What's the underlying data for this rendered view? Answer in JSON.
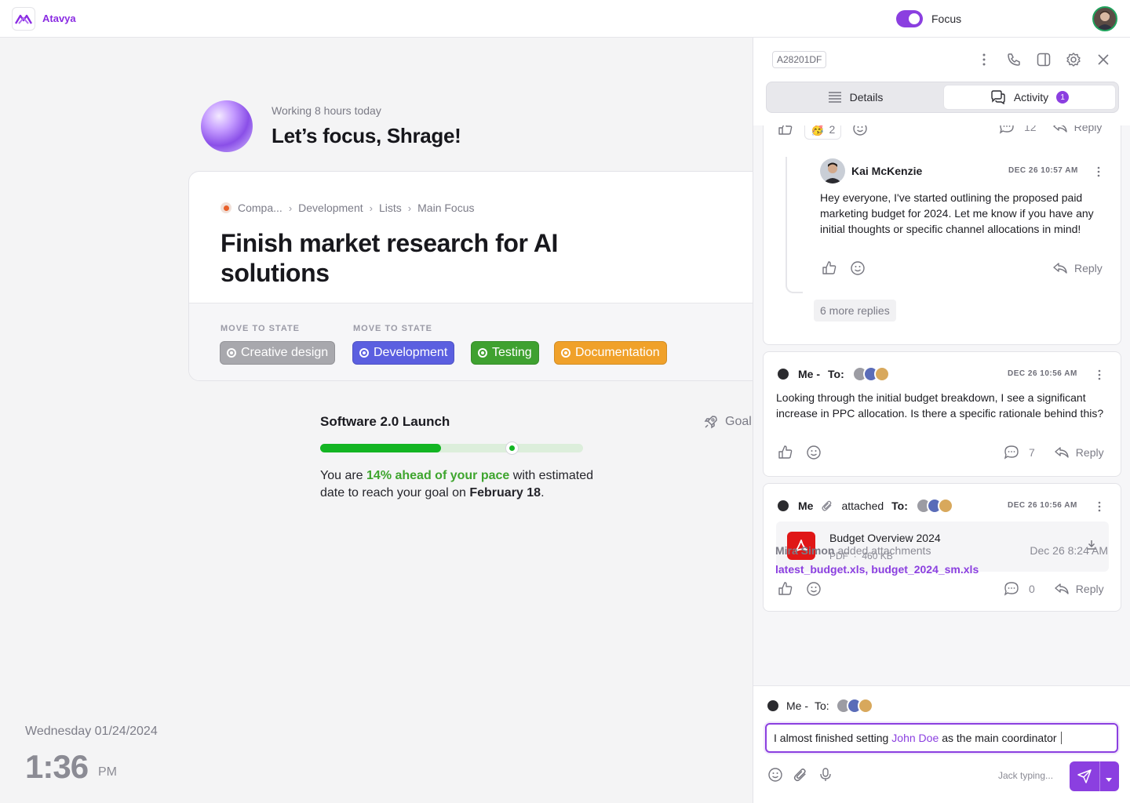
{
  "app": {
    "name": "Atavya"
  },
  "topbar": {
    "focus_label": "Focus",
    "focus_on": true
  },
  "greeting": {
    "subtitle": "Working 8 hours today",
    "title": "Let’s focus, Shrage!"
  },
  "task": {
    "breadcrumbs": [
      "Compa...",
      "Development",
      "Lists",
      "Main Focus"
    ],
    "title": "Finish market research for AI solutions",
    "state_label_1": "MOVE TO STATE",
    "state_label_2": "MOVE TO STATE",
    "states": [
      {
        "label": "Creative design",
        "color": "#a8a8ad"
      },
      {
        "label": "Development",
        "color": "#5b5fe0"
      },
      {
        "label": "Testing",
        "color": "#3fa130"
      },
      {
        "label": "Documentation",
        "color": "#f0a12a"
      }
    ]
  },
  "goal": {
    "title": "Software 2.0 Launch",
    "link_label": "Goal",
    "progress_fraction": 0.46,
    "marker_fraction": 0.73,
    "pace_prefix": "You are ",
    "pace_highlight": "14% ahead of your pace",
    "pace_middle": " with estimated date to reach your goal on ",
    "pace_date": "February 18",
    "pace_suffix": "."
  },
  "clock": {
    "date": "Wednesday 01/24/2024",
    "time": "1:36",
    "ampm": "PM"
  },
  "panel": {
    "code": "A28201DF",
    "tabs": [
      {
        "label": "Details"
      },
      {
        "label": "Activity",
        "count": "1"
      }
    ],
    "top_reactions": {
      "emoji_count": "2",
      "comments": "12",
      "reply": "Reply"
    },
    "thread_reply": {
      "author": "Kai McKenzie",
      "stamp": "DEC 26 10:57 AM",
      "text": "Hey everyone, I've started outlining the proposed paid marketing budget for 2024. Let me know if you have any initial thoughts or specific channel allocations in mind!",
      "reply": "Reply",
      "more_replies": "6 more replies"
    },
    "message2": {
      "author": "Me -",
      "to_label": "To:",
      "stamp": "DEC 26 10:56 AM",
      "text": "Looking through the initial budget breakdown, I see a significant increase in PPC allocation. Is there a specific rationale behind this?",
      "comments": "7",
      "reply": "Reply"
    },
    "message3": {
      "author": "Me",
      "action": "attached",
      "to_label": "To:",
      "stamp": "DEC 26 10:56 AM",
      "file_name": "Budget Overview 2024",
      "file_type": "PDF",
      "file_size": "460 KB",
      "comments": "0",
      "reply": "Reply"
    },
    "note": {
      "author": "Mira Simon",
      "action": " added attachments",
      "date": "Dec 26 8:24 AM",
      "files": [
        "latest_budget.xls,",
        "budget_2024_sm.xls"
      ]
    },
    "composer": {
      "from": "Me -",
      "to_label": "To:",
      "text_before": "I almost finished setting",
      "mention": "John Doe",
      "text_after": "as the main coordinator",
      "typing": "Jack typing..."
    }
  }
}
